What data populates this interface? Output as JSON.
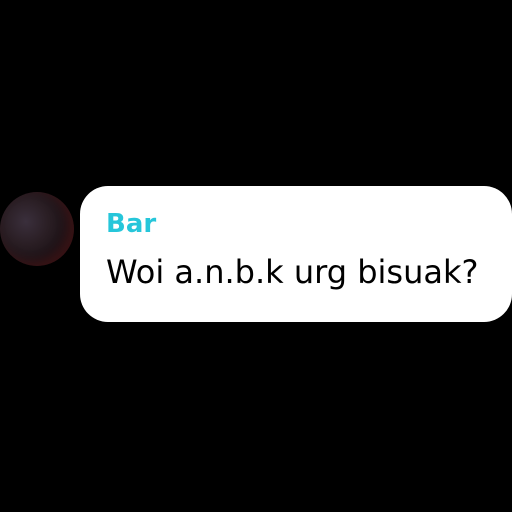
{
  "chat": {
    "message": {
      "sender": "Bar",
      "text": "Woi a.n.b.k urg bisuak?",
      "sender_color": "#26c6da"
    },
    "avatar_icon": "avatar"
  }
}
